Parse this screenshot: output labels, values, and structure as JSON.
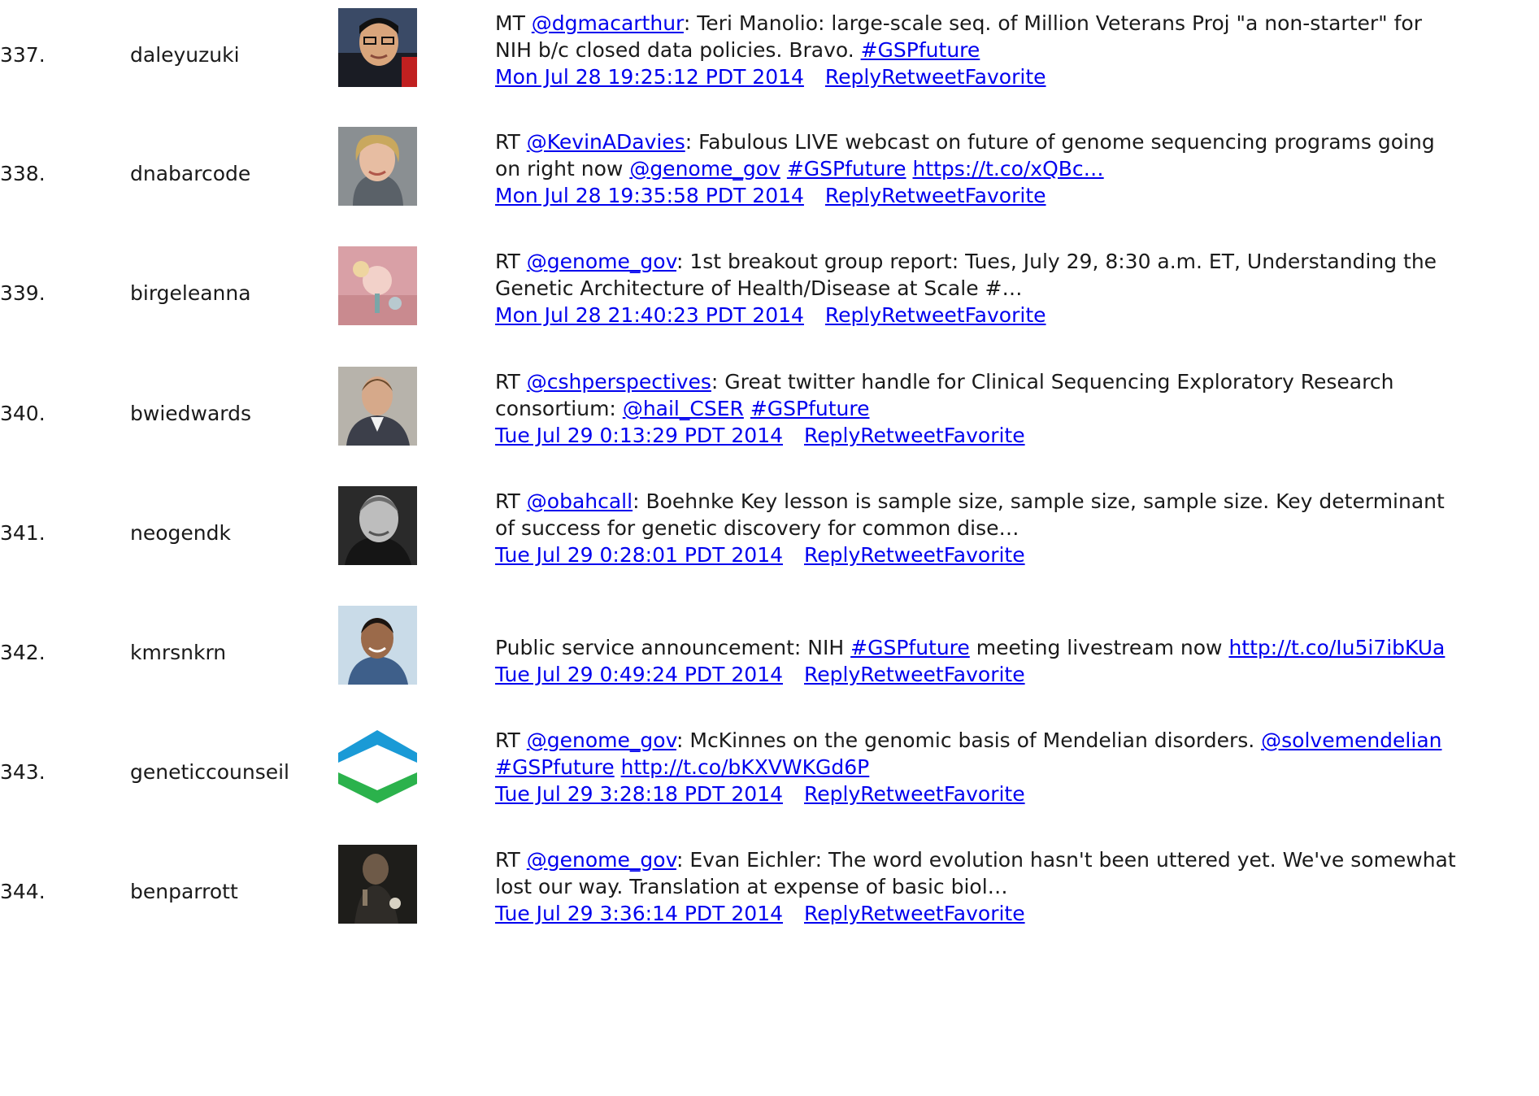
{
  "tweets": [
    {
      "num": "337.",
      "user": "daleyuzuki",
      "avatar_icon": "person-photo",
      "lines": [
        [
          {
            "t": "MT "
          },
          {
            "t": "@dgmacarthur",
            "link": true
          },
          {
            "t": ": Teri Manolio: large-scale seq. of Million Veterans Proj \"a non-starter\" for"
          }
        ],
        [
          {
            "t": "NIH b/c closed data policies. Bravo. "
          },
          {
            "t": "#GSPfuture",
            "link": true
          }
        ]
      ],
      "time": "Mon Jul 28 19:25:12 PDT 2014",
      "actions": "ReplyRetweetFavorite"
    },
    {
      "num": "338.",
      "user": "dnabarcode",
      "avatar_icon": "person-photo",
      "lines": [
        [
          {
            "t": "RT "
          },
          {
            "t": "@KevinADavies",
            "link": true
          },
          {
            "t": ": Fabulous LIVE webcast on future of genome sequencing programs going"
          }
        ],
        [
          {
            "t": "on right now "
          },
          {
            "t": "@genome_gov",
            "link": true
          },
          {
            "t": " "
          },
          {
            "t": "#GSPfuture",
            "link": true
          },
          {
            "t": " "
          },
          {
            "t": "https://t.co/xQBc…",
            "link": true
          }
        ]
      ],
      "time": "Mon Jul 28 19:35:58 PDT 2014",
      "actions": "ReplyRetweetFavorite"
    },
    {
      "num": "339.",
      "user": "birgeleanna",
      "avatar_icon": "illustration-image",
      "lines": [
        [
          {
            "t": "RT "
          },
          {
            "t": "@genome_gov",
            "link": true
          },
          {
            "t": ": 1st breakout group report: Tues, July 29, 8:30 a.m. ET, Understanding the"
          }
        ],
        [
          {
            "t": "Genetic Architecture of Health/Disease at Scale #…"
          }
        ]
      ],
      "time": "Mon Jul 28 21:40:23 PDT 2014",
      "actions": "ReplyRetweetFavorite"
    },
    {
      "num": "340.",
      "user": "bwiedwards",
      "avatar_icon": "person-photo",
      "lines": [
        [
          {
            "t": "RT "
          },
          {
            "t": "@cshperspectives",
            "link": true
          },
          {
            "t": ": Great twitter handle for Clinical Sequencing Exploratory Research"
          }
        ],
        [
          {
            "t": "consortium: "
          },
          {
            "t": "@hail_CSER",
            "link": true
          },
          {
            "t": " "
          },
          {
            "t": "#GSPfuture",
            "link": true
          }
        ]
      ],
      "time": "Tue Jul 29 0:13:29 PDT 2014",
      "actions": "ReplyRetweetFavorite"
    },
    {
      "num": "341.",
      "user": "neogendk",
      "avatar_icon": "person-photo",
      "lines": [
        [
          {
            "t": "RT "
          },
          {
            "t": "@obahcall",
            "link": true
          },
          {
            "t": ": Boehnke Key lesson is sample size, sample size, sample size. Key determinant"
          }
        ],
        [
          {
            "t": "of success for genetic discovery for common dise…"
          }
        ]
      ],
      "time": "Tue Jul 29 0:28:01 PDT 2014",
      "actions": "ReplyRetweetFavorite"
    },
    {
      "num": "342.",
      "user": "kmrsnkrn",
      "avatar_icon": "person-photo",
      "lines": [
        [
          {
            "t": "Public service announcement: NIH "
          },
          {
            "t": "#GSPfuture",
            "link": true
          },
          {
            "t": " meeting livestream now "
          },
          {
            "t": "http://t.co/Iu5i7ibKUa",
            "link": true
          }
        ]
      ],
      "time": "Tue Jul 29 0:49:24 PDT 2014",
      "actions": "ReplyRetweetFavorite"
    },
    {
      "num": "343.",
      "user": "geneticcounseil",
      "avatar_icon": "logo-chevrons",
      "lines": [
        [
          {
            "t": "RT "
          },
          {
            "t": "@genome_gov",
            "link": true
          },
          {
            "t": ": McKinnes on the genomic basis of Mendelian disorders. "
          },
          {
            "t": "@solvemendelian",
            "link": true
          }
        ],
        [
          {
            "t": "#GSPfuture",
            "link": true
          },
          {
            "t": " "
          },
          {
            "t": "http://t.co/bKXVWKGd6P",
            "link": true
          }
        ]
      ],
      "time": "Tue Jul 29 3:28:18 PDT 2014",
      "actions": "ReplyRetweetFavorite"
    },
    {
      "num": "344.",
      "user": "benparrott",
      "avatar_icon": "person-photo",
      "lines": [
        [
          {
            "t": "RT "
          },
          {
            "t": "@genome_gov",
            "link": true
          },
          {
            "t": ": Evan Eichler: The word evolution hasn't been uttered yet. We've somewhat"
          }
        ],
        [
          {
            "t": "lost our way. Translation at expense of basic biol…"
          }
        ]
      ],
      "time": "Tue Jul 29 3:36:14 PDT 2014",
      "actions": "ReplyRetweetFavorite"
    }
  ],
  "colors": {
    "link": "#0000ee",
    "text": "#1a1a1a",
    "logo_blue": "#1a9ad6",
    "logo_green": "#2bb24c"
  }
}
